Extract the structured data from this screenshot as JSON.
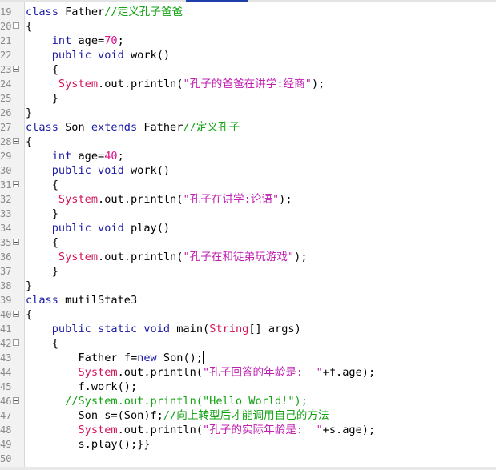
{
  "editor": {
    "lines": [
      {
        "n": "19",
        "fold": false,
        "tokens": [
          {
            "t": "class",
            "c": "kw"
          },
          {
            "t": " Father"
          },
          {
            "t": "//定义孔子爸爸",
            "c": "cmt"
          }
        ]
      },
      {
        "n": "20",
        "fold": true,
        "tokens": [
          {
            "t": "{"
          }
        ]
      },
      {
        "n": "21",
        "fold": false,
        "tokens": [
          {
            "t": "    "
          },
          {
            "t": "int",
            "c": "kw"
          },
          {
            "t": " age="
          },
          {
            "t": "70",
            "c": "num"
          },
          {
            "t": ";"
          }
        ]
      },
      {
        "n": "22",
        "fold": false,
        "tokens": [
          {
            "t": "    "
          },
          {
            "t": "public",
            "c": "kw"
          },
          {
            "t": " "
          },
          {
            "t": "void",
            "c": "kw"
          },
          {
            "t": " work()"
          }
        ]
      },
      {
        "n": "23",
        "fold": true,
        "tokens": [
          {
            "t": "    {"
          }
        ]
      },
      {
        "n": "24",
        "fold": false,
        "tokens": [
          {
            "t": "     "
          },
          {
            "t": "System",
            "c": "sys"
          },
          {
            "t": ".out.println("
          },
          {
            "t": "\"孔子的爸爸在讲学:经商\"",
            "c": "str"
          },
          {
            "t": ");"
          }
        ]
      },
      {
        "n": "25",
        "fold": false,
        "tokens": [
          {
            "t": "    }"
          }
        ]
      },
      {
        "n": "26",
        "fold": false,
        "tokens": [
          {
            "t": "}"
          }
        ]
      },
      {
        "n": "27",
        "fold": false,
        "tokens": [
          {
            "t": "class",
            "c": "kw"
          },
          {
            "t": " Son "
          },
          {
            "t": "extends",
            "c": "kw"
          },
          {
            "t": " Father"
          },
          {
            "t": "//定义孔子",
            "c": "cmt"
          }
        ]
      },
      {
        "n": "28",
        "fold": true,
        "tokens": [
          {
            "t": "{"
          }
        ]
      },
      {
        "n": "29",
        "fold": false,
        "tokens": [
          {
            "t": "    "
          },
          {
            "t": "int",
            "c": "kw"
          },
          {
            "t": " age="
          },
          {
            "t": "40",
            "c": "num"
          },
          {
            "t": ";"
          }
        ]
      },
      {
        "n": "30",
        "fold": false,
        "tokens": [
          {
            "t": "    "
          },
          {
            "t": "public",
            "c": "kw"
          },
          {
            "t": " "
          },
          {
            "t": "void",
            "c": "kw"
          },
          {
            "t": " work()"
          }
        ]
      },
      {
        "n": "31",
        "fold": true,
        "tokens": [
          {
            "t": "    {"
          }
        ]
      },
      {
        "n": "32",
        "fold": false,
        "tokens": [
          {
            "t": "     "
          },
          {
            "t": "System",
            "c": "sys"
          },
          {
            "t": ".out.println("
          },
          {
            "t": "\"孔子在讲学:论语\"",
            "c": "str"
          },
          {
            "t": ");"
          }
        ]
      },
      {
        "n": "33",
        "fold": false,
        "tokens": [
          {
            "t": "    }"
          }
        ]
      },
      {
        "n": "34",
        "fold": false,
        "tokens": [
          {
            "t": "    "
          },
          {
            "t": "public",
            "c": "kw"
          },
          {
            "t": " "
          },
          {
            "t": "void",
            "c": "kw"
          },
          {
            "t": " play()"
          }
        ]
      },
      {
        "n": "35",
        "fold": true,
        "tokens": [
          {
            "t": "    {"
          }
        ]
      },
      {
        "n": "36",
        "fold": false,
        "tokens": [
          {
            "t": "     "
          },
          {
            "t": "System",
            "c": "sys"
          },
          {
            "t": ".out.println("
          },
          {
            "t": "\"孔子在和徒弟玩游戏\"",
            "c": "str"
          },
          {
            "t": ");"
          }
        ]
      },
      {
        "n": "37",
        "fold": false,
        "tokens": [
          {
            "t": "    }"
          }
        ]
      },
      {
        "n": "38",
        "fold": false,
        "tokens": [
          {
            "t": "}"
          }
        ]
      },
      {
        "n": "39",
        "fold": false,
        "tokens": [
          {
            "t": "class",
            "c": "kw"
          },
          {
            "t": " mutilState3"
          }
        ]
      },
      {
        "n": "40",
        "fold": true,
        "tokens": [
          {
            "t": "{"
          }
        ]
      },
      {
        "n": "41",
        "fold": false,
        "tokens": [
          {
            "t": "    "
          },
          {
            "t": "public",
            "c": "kw"
          },
          {
            "t": " "
          },
          {
            "t": "static",
            "c": "kw"
          },
          {
            "t": " "
          },
          {
            "t": "void",
            "c": "kw"
          },
          {
            "t": " main("
          },
          {
            "t": "String",
            "c": "sys"
          },
          {
            "t": "[] args)"
          }
        ]
      },
      {
        "n": "42",
        "fold": true,
        "tokens": [
          {
            "t": "    {"
          }
        ]
      },
      {
        "n": "43",
        "fold": false,
        "caret": true,
        "tokens": [
          {
            "t": "        Father f="
          },
          {
            "t": "new",
            "c": "kw"
          },
          {
            "t": " Son();"
          }
        ]
      },
      {
        "n": "44",
        "fold": false,
        "tokens": [
          {
            "t": "        "
          },
          {
            "t": "System",
            "c": "sys"
          },
          {
            "t": ".out.println("
          },
          {
            "t": "\"孔子回答的年龄是:  \"",
            "c": "str"
          },
          {
            "t": "+f.age);"
          }
        ]
      },
      {
        "n": "45",
        "fold": false,
        "tokens": [
          {
            "t": "        f.work();"
          }
        ]
      },
      {
        "n": "46",
        "fold": true,
        "tokens": [
          {
            "t": "      "
          },
          {
            "t": "//System.out.println(\"Hello World!\");",
            "c": "cmt"
          }
        ]
      },
      {
        "n": "47",
        "fold": false,
        "tokens": [
          {
            "t": "        Son s=(Son)f;"
          },
          {
            "t": "//向上转型后才能调用自己的方法",
            "c": "cmt"
          }
        ]
      },
      {
        "n": "48",
        "fold": false,
        "tokens": [
          {
            "t": "        "
          },
          {
            "t": "System",
            "c": "sys"
          },
          {
            "t": ".out.println("
          },
          {
            "t": "\"孔子的实际年龄是:  \"",
            "c": "str"
          },
          {
            "t": "+s.age);"
          }
        ]
      },
      {
        "n": "49",
        "fold": false,
        "tokens": [
          {
            "t": "        s.play();}}"
          }
        ]
      },
      {
        "n": "50",
        "fold": false,
        "tokens": []
      }
    ]
  },
  "colors": {
    "keyword": "#1a1aa6",
    "number": "#e0148c",
    "system": "#d4145a",
    "string": "#c020b0",
    "comment": "#13a313"
  }
}
